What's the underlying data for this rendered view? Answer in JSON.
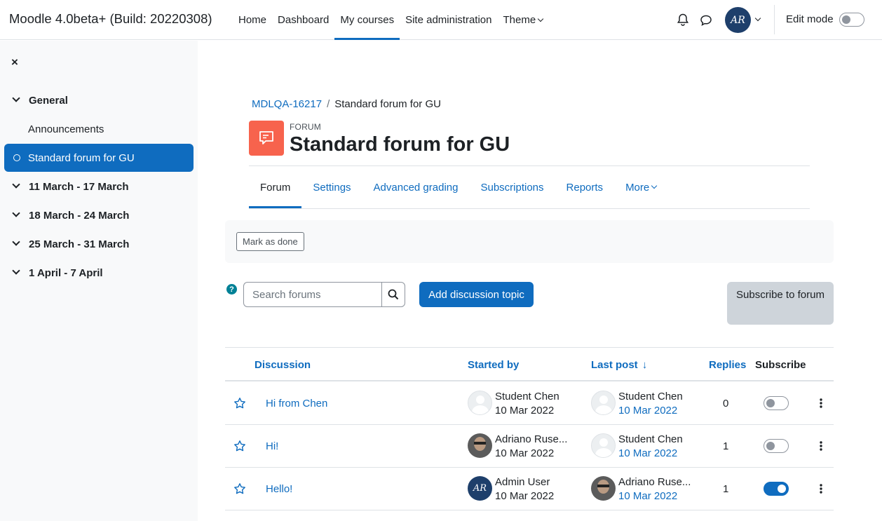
{
  "site": {
    "brand": "Moodle 4.0beta+ (Build: 20220308)"
  },
  "nav": {
    "items": [
      {
        "label": "Home"
      },
      {
        "label": "Dashboard"
      },
      {
        "label": "My courses"
      },
      {
        "label": "Site administration"
      },
      {
        "label": "Theme"
      }
    ],
    "user_initials": "AR",
    "edit_mode_label": "Edit mode"
  },
  "drawer": {
    "close": "×",
    "sections": [
      {
        "label": "General"
      },
      {
        "label": "Announcements"
      },
      {
        "label": "Standard forum for GU"
      },
      {
        "label": "11 March - 17 March"
      },
      {
        "label": "18 March - 24 March"
      },
      {
        "label": "25 March - 31 March"
      },
      {
        "label": "1 April - 7 April"
      }
    ]
  },
  "breadcrumb": {
    "course": "MDLQA-16217",
    "separator": "/",
    "current": "Standard forum for GU"
  },
  "header": {
    "kicker": "FORUM",
    "title": "Standard forum for GU"
  },
  "tabs": [
    {
      "label": "Forum"
    },
    {
      "label": "Settings"
    },
    {
      "label": "Advanced grading"
    },
    {
      "label": "Subscriptions"
    },
    {
      "label": "Reports"
    },
    {
      "label": "More"
    }
  ],
  "activity": {
    "mark_done": "Mark as done"
  },
  "toolbar": {
    "search_placeholder": "Search forums",
    "add_topic": "Add discussion topic",
    "subscribe": "Subscribe to forum"
  },
  "table": {
    "headers": {
      "discussion": "Discussion",
      "started_by": "Started by",
      "last_post": "Last post",
      "last_post_arrow": "↓",
      "replies": "Replies",
      "subscribe": "Subscribe"
    },
    "rows": [
      {
        "title": "Hi from Chen",
        "starter": "Student Chen",
        "start_date": "10 Mar 2022",
        "last_by": "Student Chen",
        "last_date": "10 Mar 2022",
        "replies": "0",
        "subscribed": false
      },
      {
        "title": "Hi!",
        "starter": "Adriano Ruse...",
        "start_date": "10 Mar 2022",
        "last_by": "Student Chen",
        "last_date": "10 Mar 2022",
        "replies": "1",
        "subscribed": false
      },
      {
        "title": "Hello!",
        "starter": "Admin User",
        "start_date": "10 Mar 2022",
        "last_by": "Adriano Ruse...",
        "last_date": "10 Mar 2022",
        "replies": "1",
        "subscribed": true
      }
    ]
  },
  "colors": {
    "primary": "#0f6cbf",
    "forum_icon": "#f7634d",
    "drawer_bg": "#f8f9fa"
  }
}
